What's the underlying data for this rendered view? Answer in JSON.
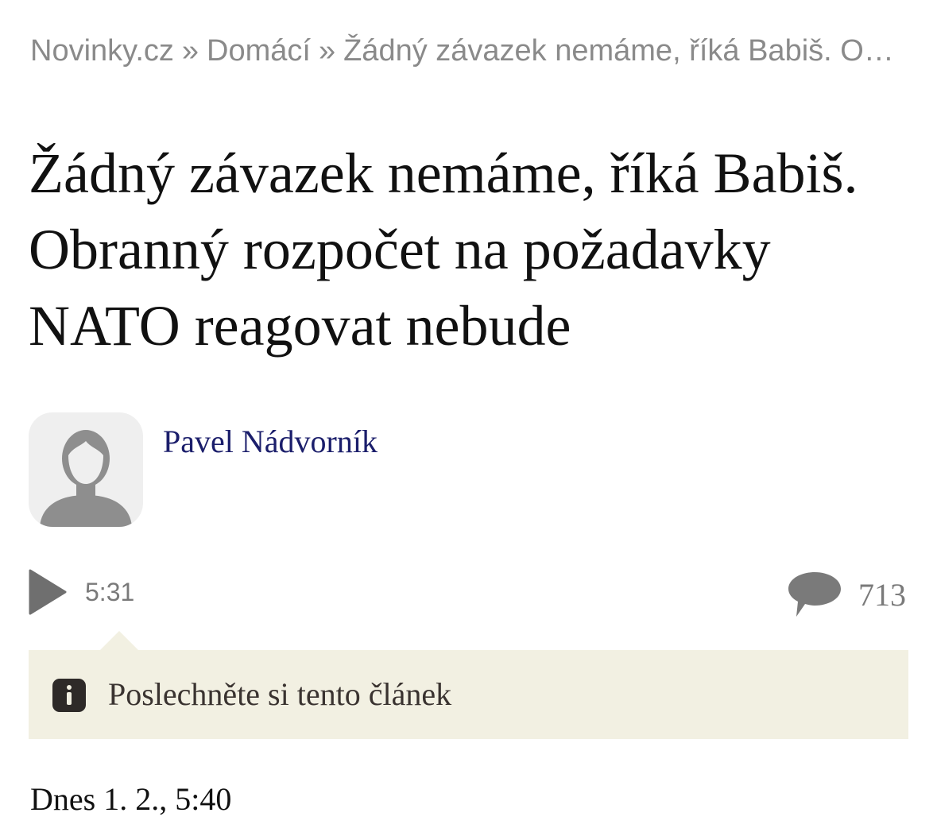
{
  "breadcrumb": {
    "items": [
      "Novinky.cz",
      "Domácí",
      "Žádný závazek nemáme, říká Babiš. Obranný rozpočet na požadavky NATO reagovat nebude"
    ],
    "separator": "»"
  },
  "article": {
    "title": "Žádný závazek nemáme, říká Babiš. Obranný rozpočet na požadavky NATO reagovat nebude",
    "author": "Pavel Nádvorník",
    "audio_duration": "5:31",
    "comment_count": "713",
    "listen_prompt": "Poslechněte si tento článek",
    "date": "Dnes 1. 2., 5:40"
  },
  "icons": {
    "avatar": "default-user-avatar-icon",
    "play": "play-icon",
    "comments": "speech-bubble-icon",
    "info": "info-icon"
  },
  "colors": {
    "author_link": "#1b1e6b",
    "muted_text": "#8a8a8a",
    "listen_box_bg": "#f2f0e2"
  }
}
